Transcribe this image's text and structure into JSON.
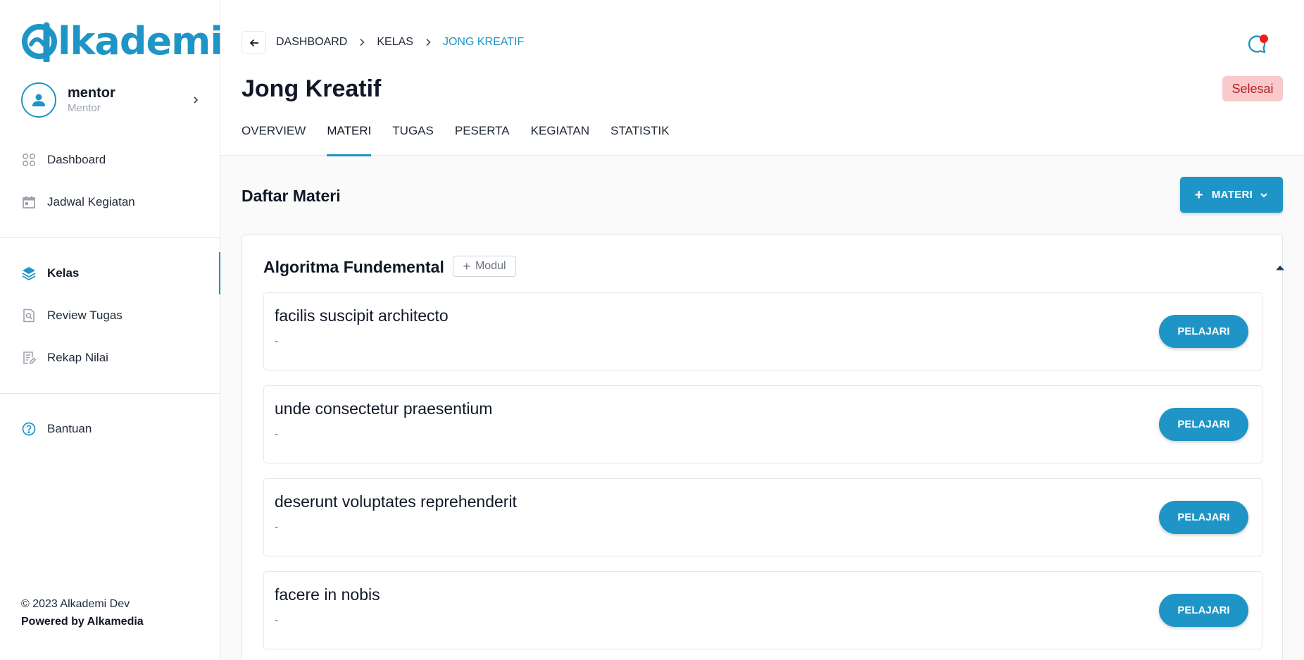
{
  "brand": {
    "logo_text": "lkademi",
    "color": "#1e95c6"
  },
  "user": {
    "name": "mentor",
    "role": "Mentor"
  },
  "sidebar": {
    "items": [
      {
        "label": "Dashboard",
        "icon": "grid-icon"
      },
      {
        "label": "Jadwal Kegiatan",
        "icon": "calendar-icon"
      },
      {
        "label": "Kelas",
        "icon": "layers-icon",
        "active": true
      },
      {
        "label": "Review Tugas",
        "icon": "search-document-icon"
      },
      {
        "label": "Rekap Nilai",
        "icon": "edit-document-icon"
      },
      {
        "label": "Bantuan",
        "icon": "help-circle-icon"
      }
    ]
  },
  "footer": {
    "copyright": "© 2023 Alkademi Dev",
    "powered": "Powered by Alkamedia"
  },
  "breadcrumb": {
    "items": [
      "DASHBOARD",
      "KELAS",
      "JONG KREATIF"
    ]
  },
  "page": {
    "title": "Jong Kreatif",
    "status": "Selesai"
  },
  "tabs": [
    {
      "label": "OVERVIEW"
    },
    {
      "label": "MATERI",
      "active": true
    },
    {
      "label": "TUGAS"
    },
    {
      "label": "PESERTA"
    },
    {
      "label": "KEGIATAN"
    },
    {
      "label": "STATISTIK"
    }
  ],
  "content": {
    "section_title": "Daftar Materi",
    "add_button": "MATERI",
    "module": {
      "title": "Algoritma Fundemental",
      "add_module_label": "Modul",
      "lessons": [
        {
          "title": "facilis suscipit architecto",
          "desc": "-",
          "button": "PELAJARI"
        },
        {
          "title": "unde consectetur praesentium",
          "desc": "-",
          "button": "PELAJARI"
        },
        {
          "title": "deserunt voluptates reprehenderit",
          "desc": "-",
          "button": "PELAJARI"
        },
        {
          "title": "facere in nobis",
          "desc": "-",
          "button": "PELAJARI"
        }
      ]
    }
  },
  "notification": {
    "has_unread": true,
    "dot_color": "#ef1c1c"
  }
}
